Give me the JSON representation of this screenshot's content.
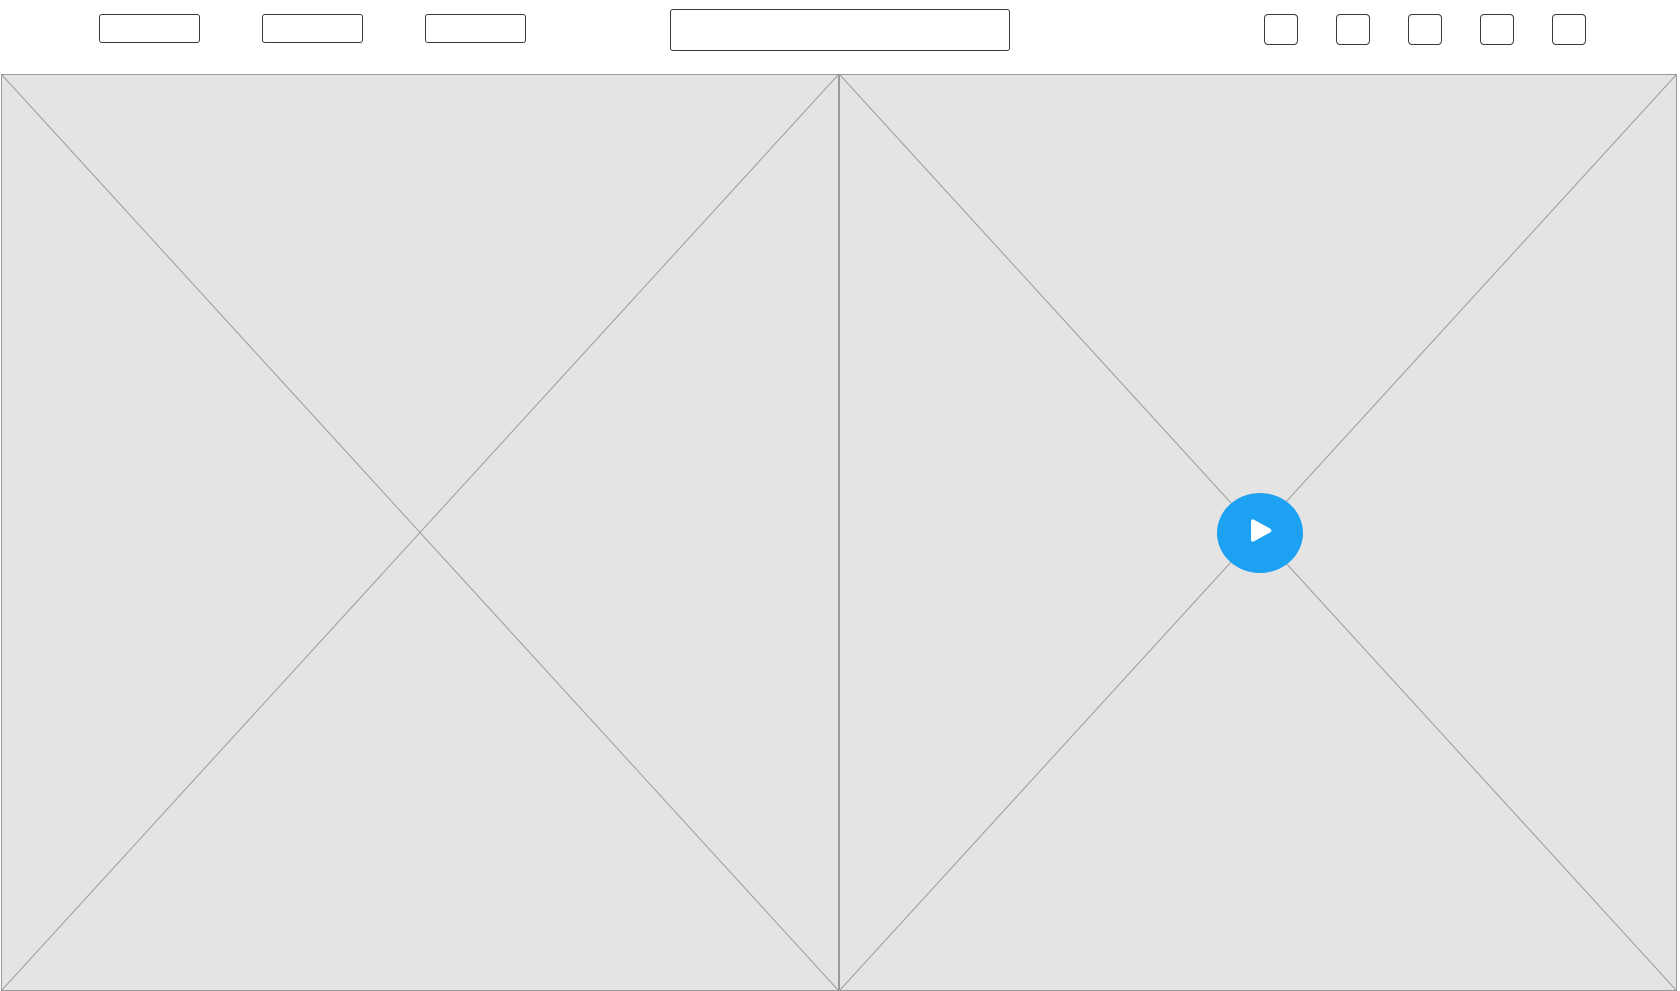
{
  "toolbar": {
    "nav_buttons": [
      "",
      "",
      ""
    ],
    "search": {
      "value": "",
      "placeholder": ""
    },
    "icon_buttons": [
      "",
      "",
      "",
      "",
      ""
    ]
  },
  "media": {
    "left_panel": {
      "kind": "image-placeholder"
    },
    "right_panel": {
      "kind": "video-placeholder",
      "play_icon": "play-icon"
    }
  },
  "colors": {
    "accent": "#1da1f2",
    "placeholder_fill": "#e4e4e4",
    "placeholder_stroke": "#9a9a9a",
    "outline": "#3a3a3a"
  }
}
